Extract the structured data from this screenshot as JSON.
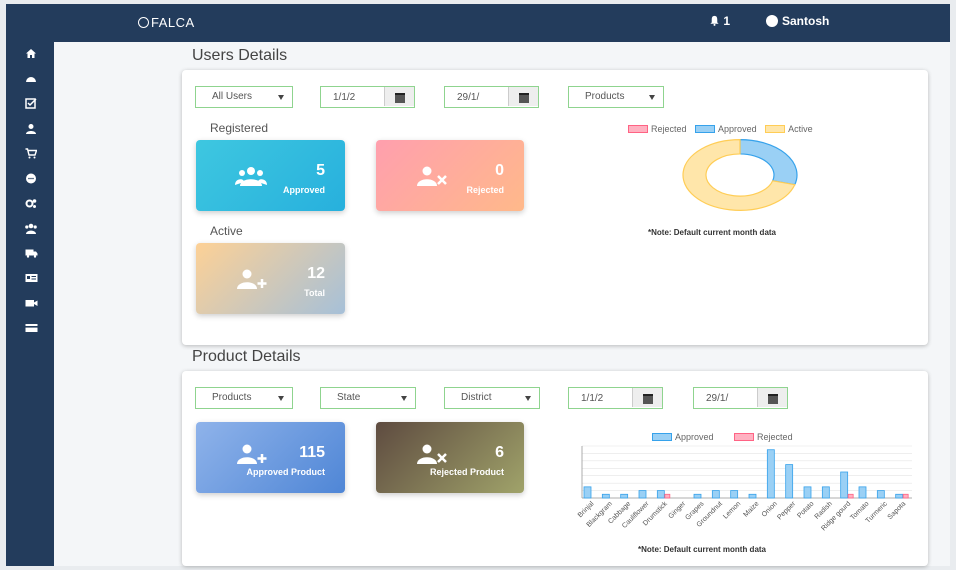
{
  "header": {
    "brand": "FALCA",
    "notif_count": "1",
    "user_name": "Santosh"
  },
  "sidebar": {
    "icons": [
      "home-icon",
      "dashboard-icon",
      "checklist-icon",
      "user-icon",
      "cart-icon",
      "chat-icon",
      "settings-icon",
      "group-icon",
      "truck-icon",
      "id-card-icon",
      "video-icon",
      "card-icon"
    ]
  },
  "users": {
    "title": "Users Details",
    "filter_user": "All Users",
    "date_from": "1/1/2",
    "date_to": "29/1/",
    "filter_product": "Products",
    "registered_label": "Registered",
    "active_label": "Active",
    "approved_value": "5",
    "approved_label": "Approved",
    "rejected_value": "0",
    "rejected_label": "Rejected",
    "total_value": "12",
    "total_label": "Total",
    "note": "*Note: Default current month data",
    "legend": [
      "Rejected",
      "Approved",
      "Active"
    ]
  },
  "products": {
    "title": "Product Details",
    "filter_product": "Products",
    "filter_state": "State",
    "filter_district": "District",
    "date_from": "1/1/2",
    "date_to": "29/1/",
    "approved_value": "115",
    "approved_label": "Approved Product",
    "rejected_value": "6",
    "rejected_label": "Rejected Product",
    "note": "*Note: Default current month data",
    "legend": [
      "Approved",
      "Rejected"
    ]
  },
  "colors": {
    "approved": "#36a2eb",
    "rejected": "#ff6384",
    "active": "#ffcd56",
    "nav": "#233c5c"
  },
  "chart_data": [
    {
      "type": "pie",
      "labels": [
        "Rejected",
        "Approved",
        "Active"
      ],
      "values": [
        0,
        5,
        12
      ]
    },
    {
      "type": "bar",
      "categories": [
        "Brinjal",
        "Blackgram",
        "Cabbage",
        "Cauliflower",
        "Drumstick",
        "Ginger",
        "Grapes",
        "Groundnut",
        "Lemon",
        "Maize",
        "Onion",
        "Pepper",
        "Potato",
        "Radish",
        "Ridge gourd",
        "Tomato",
        "Turmeric",
        "Sapota"
      ],
      "series": [
        {
          "name": "Approved",
          "values": [
            3,
            1,
            1,
            2,
            2,
            0,
            1,
            2,
            2,
            1,
            13,
            9,
            3,
            3,
            7,
            3,
            2,
            1
          ]
        },
        {
          "name": "Rejected",
          "values": [
            0,
            0,
            0,
            0,
            1,
            0,
            0,
            0,
            0,
            0,
            0,
            0,
            0,
            0,
            1,
            0,
            0,
            1
          ]
        }
      ]
    }
  ]
}
